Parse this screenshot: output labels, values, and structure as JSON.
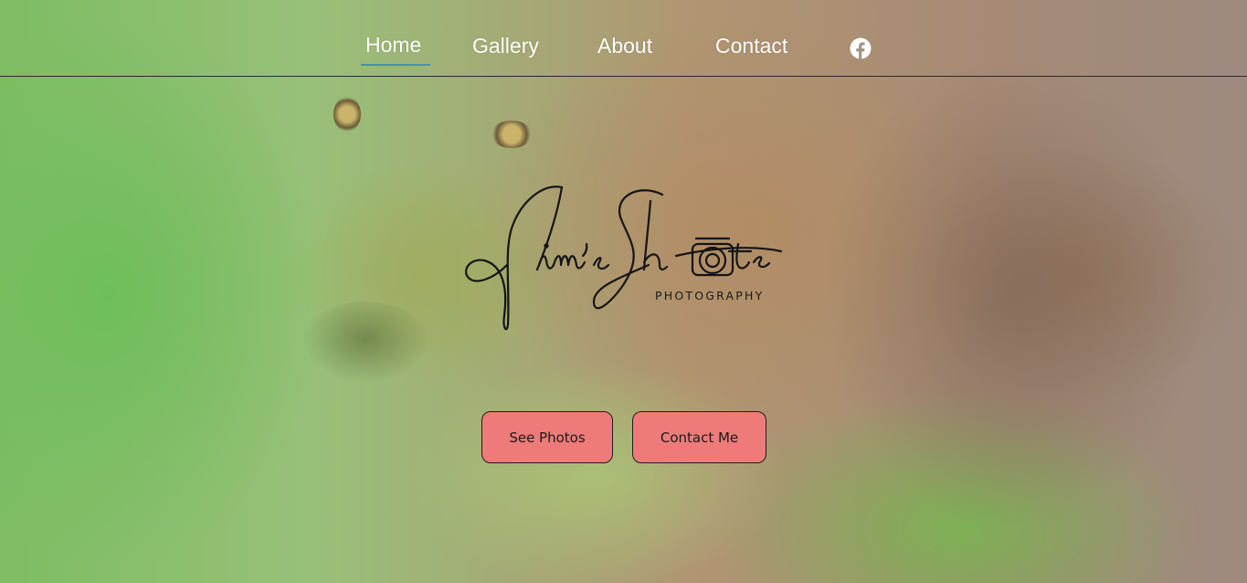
{
  "nav": {
    "items": [
      {
        "label": "Home",
        "active": true
      },
      {
        "label": "Gallery"
      },
      {
        "label": "About"
      },
      {
        "label": "Contact"
      }
    ],
    "social_icon": "facebook-icon",
    "active_underline_color": "#4a8fb0"
  },
  "hero": {
    "logo_script": "Jim's Shots",
    "logo_subtitle": "PHOTOGRAPHY",
    "buttons": {
      "see_photos": "See Photos",
      "contact_me": "Contact Me"
    },
    "button_color": "#ee7b79"
  },
  "colors": {
    "nav_text": "#ffffff",
    "logo_ink": "#1a1a1a"
  }
}
